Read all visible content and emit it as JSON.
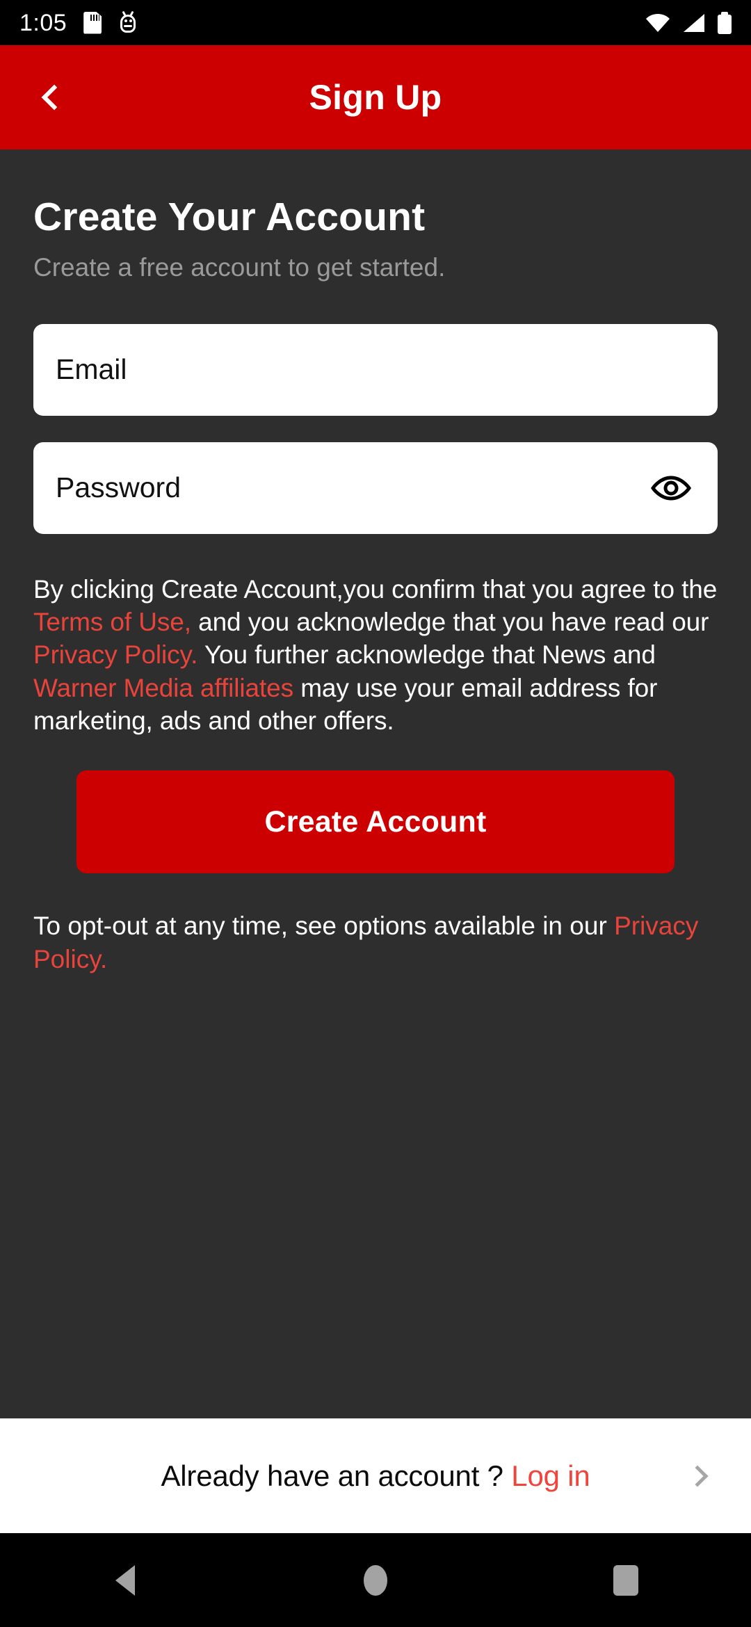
{
  "status_bar": {
    "time": "1:05",
    "icons_left": [
      "sd-card-icon",
      "android-bug-icon"
    ],
    "icons_right": [
      "wifi-icon",
      "cellular-signal-icon",
      "battery-icon"
    ]
  },
  "header": {
    "title": "Sign Up",
    "back_icon": "chevron-left-icon",
    "background_color": "#CC0000"
  },
  "content": {
    "title": "Create Your Account",
    "subtitle": "Create a free account to get started.",
    "background_color": "#2E2E2E",
    "fields": {
      "email": {
        "placeholder": "Email",
        "value": ""
      },
      "password": {
        "placeholder": "Password",
        "value": "",
        "toggle_icon": "eye-icon"
      }
    },
    "legal": {
      "part1": "By clicking Create Account,you confirm that you agree to the ",
      "link1": "Terms of Use,",
      "part2": " and you acknowledge that you have read our ",
      "link2": "Privacy Policy.",
      "part3": " You further acknowledge that News and ",
      "link3": "Warner Media affiliates",
      "part4": " may use your email address for marketing, ads and other offers."
    },
    "cta_label": "Create Account",
    "optout": {
      "part1": "To opt-out at any time, see options available in our ",
      "link1": "Privacy Policy."
    },
    "link_color": "#E8443C"
  },
  "login_bar": {
    "prompt": "Already have an account ?",
    "link": "Log in",
    "chevron_icon": "chevron-right-icon",
    "link_color": "#F0453C"
  },
  "nav_bar": {
    "back_icon": "triangle-back-icon",
    "home_icon": "circle-home-icon",
    "recents_icon": "square-recents-icon"
  }
}
